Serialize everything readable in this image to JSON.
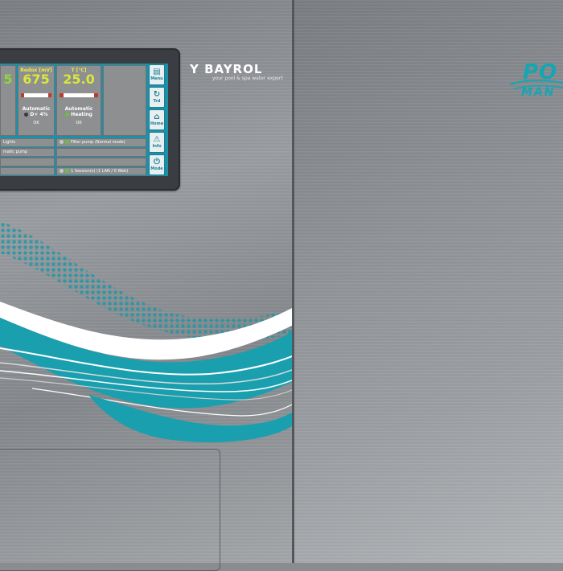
{
  "brand": {
    "name": "BAYROL",
    "tagline": "your pool & spa water expert"
  },
  "product": {
    "line1": "PO",
    "line2": "MAN"
  },
  "display": {
    "tiles": [
      {
        "header": "",
        "value": "5",
        "mode": "",
        "mode2": "",
        "status": ""
      },
      {
        "header": "Redox [mV]",
        "value": "675",
        "mode": "Automatic",
        "mode2": "D+ 4%",
        "status": "OK"
      },
      {
        "header": "T [°C]",
        "value": "25.0",
        "mode": "Automatic",
        "mode2": "Heating",
        "status": "OK"
      }
    ],
    "rows": [
      {
        "label": "Lights"
      },
      {
        "label": "Filter pump (Normal mode)"
      },
      {
        "label": "matic pump"
      },
      {
        "label": "1 Session(s) (1 LAN / 0 Web)"
      }
    ],
    "buttons": [
      {
        "label": "Menu",
        "icon": "menu-icon"
      },
      {
        "label": "Trd",
        "icon": "trend-icon"
      },
      {
        "label": "Home",
        "icon": "home-icon"
      },
      {
        "label": "Info",
        "icon": "alarm-icon"
      },
      {
        "label": "Mode",
        "icon": "power-icon"
      }
    ]
  },
  "colors": {
    "accent": "#1a9fae",
    "screen": "#1d8fa6",
    "value": "#d9e83a"
  }
}
